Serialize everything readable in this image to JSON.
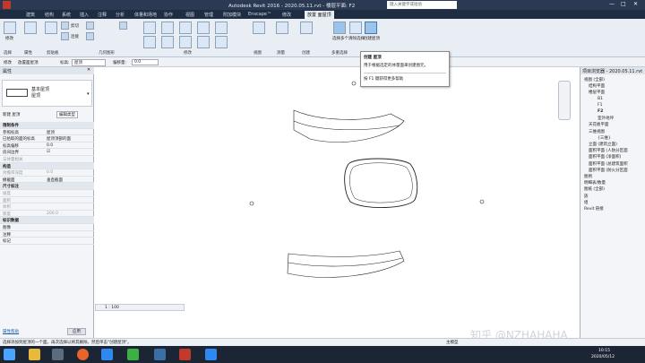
{
  "app": {
    "title": "Autodesk Revit 2016 -    2020.05.11.rvt - 楼层平面: F2",
    "search_placeholder": "键入关键字或短语"
  },
  "ribbon_tabs": [
    "建筑",
    "结构",
    "系统",
    "插入",
    "注释",
    "分析",
    "体量和场地",
    "协作",
    "视图",
    "管理",
    "附加模块",
    "Enscape™",
    "修改",
    "放置 面屋顶"
  ],
  "active_tab_index": 13,
  "ribbon": {
    "modify_label": "修改",
    "cut_label": "剪切",
    "join_label": "连接",
    "clipboard_label": "剪贴板",
    "geometry_label": "几何图形",
    "modify_panel_label": "修改",
    "view_label": "视图",
    "measure_label": "测量",
    "create_label": "创建",
    "multi_select_label": "多重选择",
    "select_label": "选择",
    "properties_label": "属性",
    "select_multiple": "选择多个",
    "clear_selection": "清除选择",
    "create_roof": "创建屋顶"
  },
  "optbar": {
    "modify_label": "修改",
    "context_label": "放置面屋顶",
    "height_label": "标高:",
    "height_value": "屋顶",
    "offset_label": "偏移量:",
    "offset_value": "0.0"
  },
  "tooltip": {
    "title": "创建 屋顶",
    "description": "用于根据选定的体量面来创建图元。",
    "help": "按 F1 键获得更多帮助"
  },
  "properties": {
    "header": "属性",
    "type_name": "基本屋顶\n屋顶",
    "instance_label": "新建 屋顶",
    "edit_type": "编辑类型",
    "rows": [
      {
        "k": "限制条件",
        "v": "",
        "group": true
      },
      {
        "k": "参照标高",
        "v": "屋顶"
      },
      {
        "k": "已拾取的面的标高",
        "v": "屋顶顶部的面"
      },
      {
        "k": "标高偏移",
        "v": "0.0"
      },
      {
        "k": "房间边界",
        "v": "☑"
      },
      {
        "k": "与体量相关",
        "v": "",
        "dim": true
      },
      {
        "k": "构造",
        "v": "",
        "group": true
      },
      {
        "k": "封檐带深度",
        "v": "0.0",
        "dim": true
      },
      {
        "k": "椽截面",
        "v": "垂直截面"
      },
      {
        "k": "尺寸标注",
        "v": "",
        "group": true
      },
      {
        "k": "坡度",
        "v": "",
        "dim": true
      },
      {
        "k": "面积",
        "v": "",
        "dim": true
      },
      {
        "k": "体积",
        "v": "",
        "dim": true
      },
      {
        "k": "厚度",
        "v": "200.0",
        "dim": true
      },
      {
        "k": "标识数据",
        "v": "",
        "group": true
      },
      {
        "k": "图像",
        "v": ""
      },
      {
        "k": "注释",
        "v": ""
      },
      {
        "k": "标记",
        "v": ""
      }
    ],
    "help_link": "属性帮助",
    "apply_button": "应用"
  },
  "browser": {
    "header": "项目浏览器 - 2020.05.11.rvt",
    "items": [
      {
        "label": "视图 (全部)",
        "indent": 0
      },
      {
        "label": "结构平面",
        "indent": 1
      },
      {
        "label": "楼层平面",
        "indent": 1
      },
      {
        "label": "B1",
        "indent": 3
      },
      {
        "label": "F1",
        "indent": 3
      },
      {
        "label": "F2",
        "indent": 3,
        "bold": true
      },
      {
        "label": "室外地坪",
        "indent": 3
      },
      {
        "label": "天花板平面",
        "indent": 1
      },
      {
        "label": "三维视图",
        "indent": 1
      },
      {
        "label": "{三维}",
        "indent": 3
      },
      {
        "label": "立面 (建筑立面)",
        "indent": 1
      },
      {
        "label": "面积平面 (人防分区面",
        "indent": 1
      },
      {
        "label": "面积平面 (净面积)",
        "indent": 1
      },
      {
        "label": "面积平面 (总建筑面积",
        "indent": 1
      },
      {
        "label": "面积平面 (防火分区面",
        "indent": 1
      },
      {
        "label": "图例",
        "indent": 0
      },
      {
        "label": "明细表/数量",
        "indent": 0
      },
      {
        "label": "图纸 (全部)",
        "indent": 0
      },
      {
        "label": "族",
        "indent": 0
      },
      {
        "label": "组",
        "indent": 0
      },
      {
        "label": "Revit 链接",
        "indent": 0
      }
    ]
  },
  "view_control": {
    "scale": "1 : 100"
  },
  "status": {
    "message": "选择添加到屋顶的一个面。再次选择以将其删除。然后单击\"创建屋顶\"。",
    "main_model": "主模型"
  },
  "watermark": "知乎 @NZHAHAHA",
  "clock": {
    "time": "10:15",
    "date": "2020/05/12"
  }
}
